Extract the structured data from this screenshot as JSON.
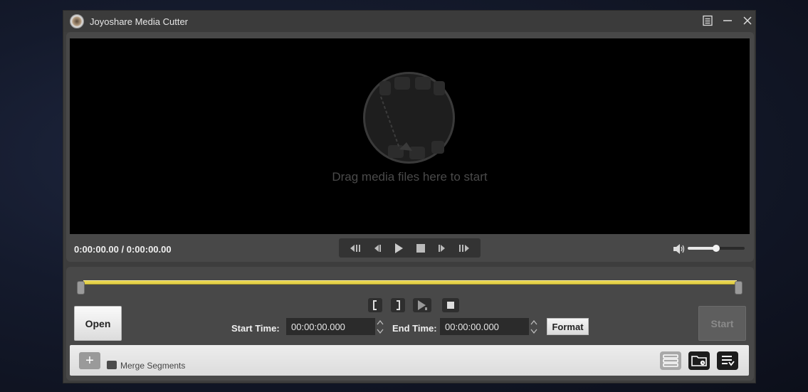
{
  "window": {
    "title": "Joyoshare Media Cutter"
  },
  "preview": {
    "drop_hint": "Drag media files here to start",
    "time_display": "0:00:00.00 / 0:00:00.00",
    "volume_level": 0.5
  },
  "trim": {
    "open_label": "Open",
    "start_label": "Start",
    "start_time_label": "Start Time:",
    "start_time_value": "00:00:00.000",
    "end_time_label": "End Time:",
    "end_time_value": "00:00:00.000",
    "format_label": "Format"
  },
  "bottom_bar": {
    "add_label": "+",
    "merge_label": "Merge Segments"
  },
  "colors": {
    "trim_bar": "#e5d24a",
    "panel": "#484848",
    "video_bg": "#000000"
  },
  "icons": [
    "app-logo-icon",
    "menu-icon",
    "minimize-icon",
    "close-icon",
    "film-reel-icon",
    "rewind-fast-icon",
    "step-back-icon",
    "play-icon",
    "stop-icon",
    "step-forward-icon",
    "forward-fast-icon",
    "volume-icon",
    "mark-in-icon",
    "mark-out-icon",
    "play-segment-icon",
    "stop-segment-icon",
    "edit-list-icon",
    "output-folder-icon",
    "task-list-icon"
  ]
}
